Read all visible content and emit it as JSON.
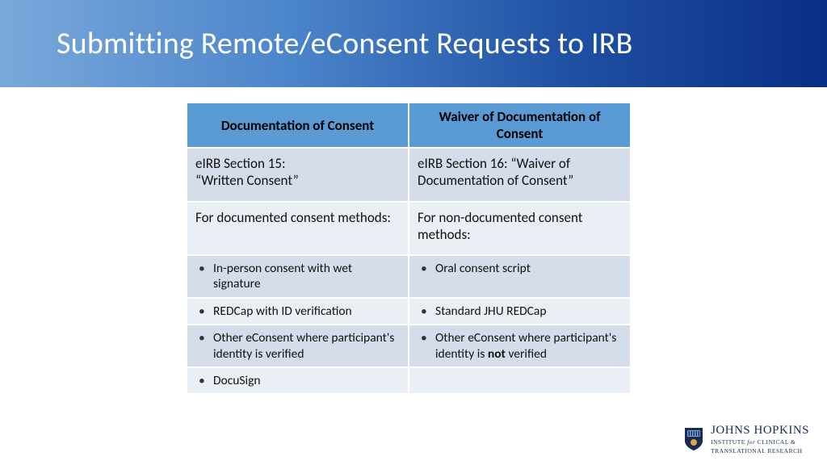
{
  "title": "Submitting Remote/eConsent Requests to IRB",
  "table": {
    "headers": [
      "Documentation of Consent",
      "Waiver of Documentation of Consent"
    ],
    "rows": [
      {
        "left_line1": "eIRB Section 15:",
        "left_line2": "“Written Consent”",
        "right": "eIRB Section 16: “Waiver of Documentation of Consent”"
      },
      {
        "left": "For documented consent methods:",
        "right": "For non-documented consent methods:"
      },
      {
        "left": "In-person consent with wet signature",
        "right": "Oral consent script"
      },
      {
        "left": "REDCap with ID verification",
        "right": "Standard JHU REDCap"
      },
      {
        "left": "Other eConsent where participant's identity is verified",
        "right_pre": "Other eConsent where participant's identity is",
        "right_bold": "not",
        "right_post": "verified"
      },
      {
        "left": "DocuSign"
      }
    ]
  },
  "logo": {
    "brand": "JOHNS HOPKINS",
    "sub1": "INSTITUTE",
    "sub_for": "for",
    "sub2": "CLINICAL &",
    "sub3": "TRANSLATIONAL RESEARCH"
  }
}
